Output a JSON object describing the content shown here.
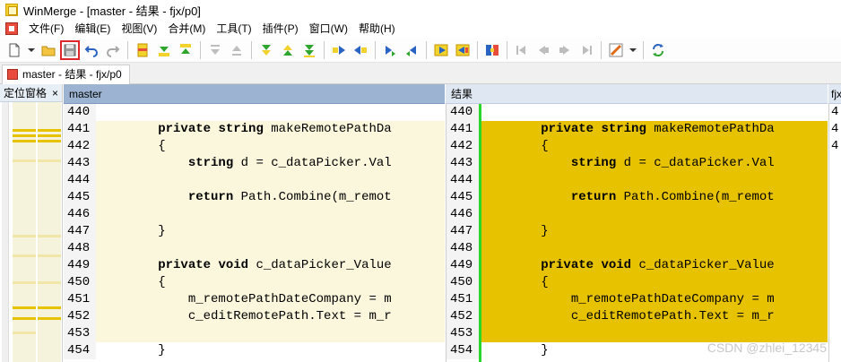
{
  "window": {
    "title": "WinMerge - [master - 结果 - fjx/p0]"
  },
  "menu": [
    "文件(F)",
    "编辑(E)",
    "视图(V)",
    "合并(M)",
    "工具(T)",
    "插件(P)",
    "窗口(W)",
    "帮助(H)"
  ],
  "toolbar": {
    "buttons": [
      "new-icon",
      "dropdown",
      "open-folder-icon",
      "save-icon",
      "undo-icon",
      "redo-icon",
      "sep",
      "merge-marker-icon",
      "next-diff-icon",
      "prev-diff-icon",
      "sep",
      "first-diff-icon",
      "last-diff-icon",
      "sep",
      "next-conflict-icon",
      "prev-conflict-icon",
      "all-diff-icon",
      "sep",
      "copy-right-icon",
      "copy-left-icon",
      "sep",
      "copy-right-advance-icon",
      "copy-left-advance-icon",
      "sep",
      "copy-all-right-icon",
      "copy-all-left-icon",
      "sep",
      "compare-icon",
      "sep",
      "nav-first-icon",
      "nav-prev-icon",
      "nav-next-icon",
      "nav-last-icon",
      "sep",
      "options-icon",
      "dropdown",
      "sep",
      "refresh-icon"
    ],
    "highlighted": "save-icon"
  },
  "tab": {
    "label": "master - 结果 - fjx/p0"
  },
  "location_pane": {
    "title": "定位窗格",
    "close": "×"
  },
  "panes": {
    "left_header": "master",
    "right_header": "结果",
    "third_header": "fjx"
  },
  "lines": [
    {
      "n": "440",
      "left": "",
      "right": "",
      "diff": false
    },
    {
      "n": "441",
      "left": "        private string makeRemotePathDa",
      "right": "        private string makeRemotePathDa",
      "diff": true
    },
    {
      "n": "442",
      "left": "        {",
      "right": "        {",
      "diff": true
    },
    {
      "n": "443",
      "left": "            string d = c_dataPicker.Val",
      "right": "            string d = c_dataPicker.Val",
      "diff": true
    },
    {
      "n": "444",
      "left": "",
      "right": "",
      "diff": true
    },
    {
      "n": "445",
      "left": "            return Path.Combine(m_remot",
      "right": "            return Path.Combine(m_remot",
      "diff": true
    },
    {
      "n": "446",
      "left": "",
      "right": "",
      "diff": true
    },
    {
      "n": "447",
      "left": "        }",
      "right": "        }",
      "diff": true
    },
    {
      "n": "448",
      "left": "",
      "right": "",
      "diff": true
    },
    {
      "n": "449",
      "left": "        private void c_dataPicker_Value",
      "right": "        private void c_dataPicker_Value",
      "diff": true
    },
    {
      "n": "450",
      "left": "        {",
      "right": "        {",
      "diff": true
    },
    {
      "n": "451",
      "left": "            m_remotePathDateCompany = m",
      "right": "            m_remotePathDateCompany = m",
      "diff": true
    },
    {
      "n": "452",
      "left": "            c_editRemotePath.Text = m_r",
      "right": "            c_editRemotePath.Text = m_r",
      "diff": true
    },
    {
      "n": "453",
      "left": "",
      "right": "",
      "diff": true
    },
    {
      "n": "454",
      "left": "        }",
      "right": "        }",
      "diff": false
    }
  ],
  "third_pane_lines": [
    "4",
    "4",
    "4",
    "",
    "",
    "",
    "",
    "",
    "",
    "",
    "",
    "",
    "",
    "",
    ""
  ],
  "watermark": "CSDN @zhlei_12345",
  "colors": {
    "diff_left": "#fbf7dc",
    "diff_right": "#e7c200",
    "merge_bar": "#29d629",
    "header_active": "#9cb4d2",
    "save_highlight": "#e0262a"
  }
}
